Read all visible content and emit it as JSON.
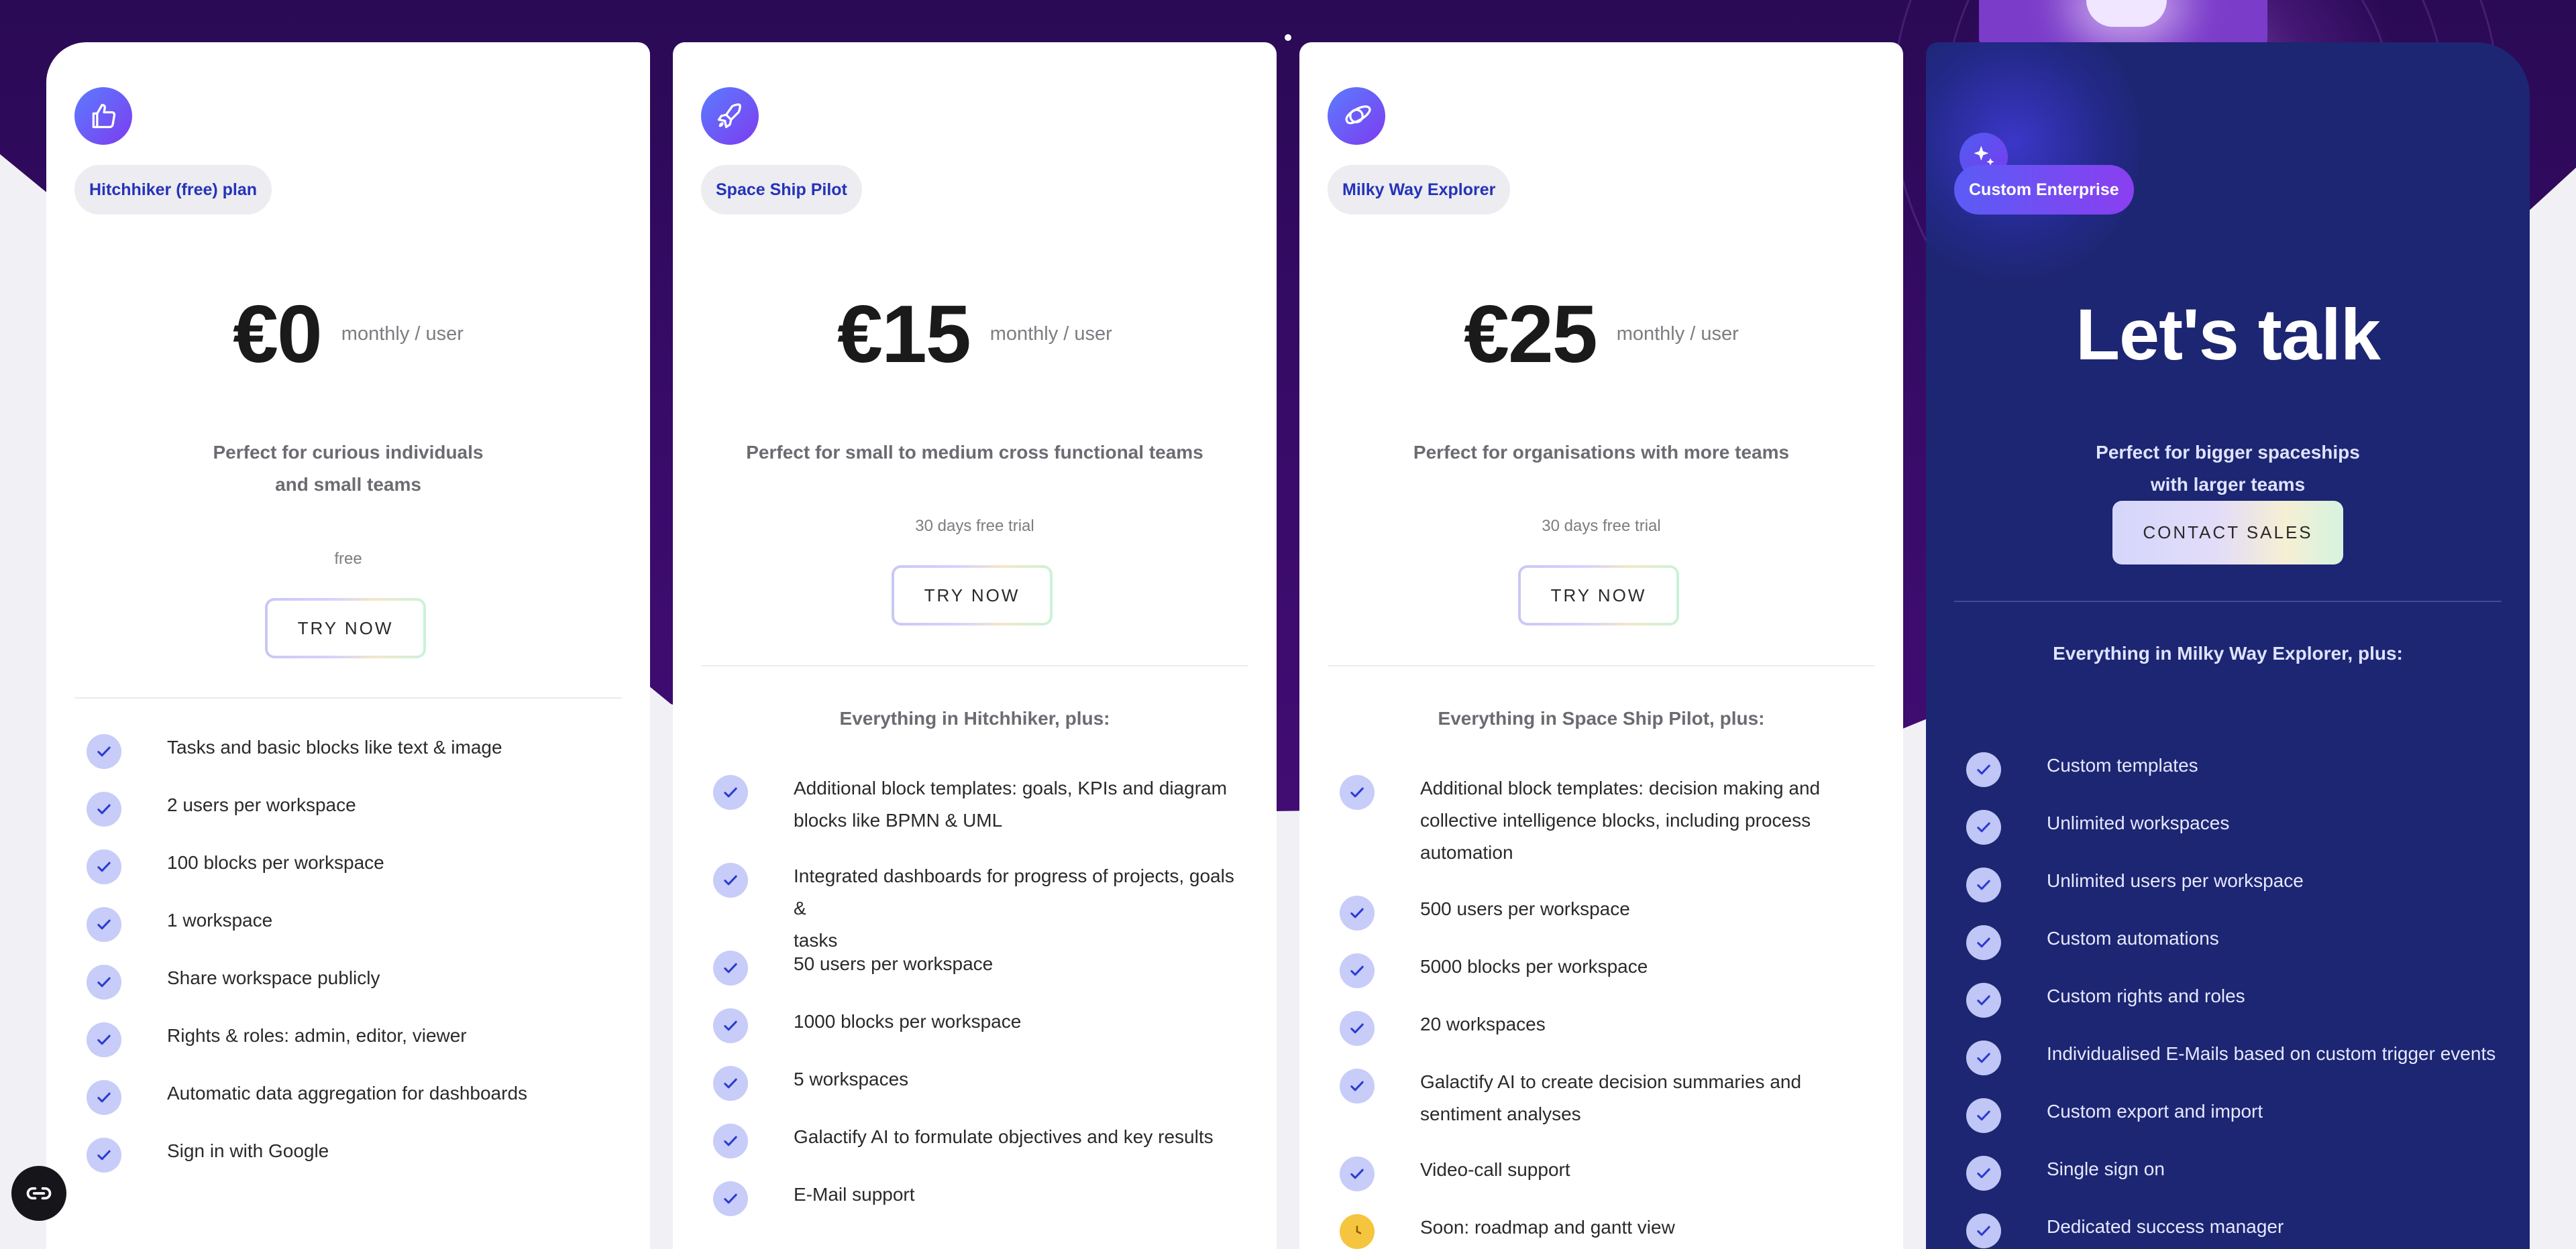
{
  "plans": [
    {
      "pill": "Hitchhiker (free) plan",
      "icon": "thumbs-up-icon",
      "price": "€0",
      "unit": "monthly / user",
      "desc_line1": "Perfect for curious individuals",
      "desc_line2": "and small teams",
      "note": "free",
      "button": "TRY NOW",
      "section_head": "",
      "features": [
        "Tasks and basic blocks like text & image",
        "2 users per workspace",
        "100 blocks per workspace",
        "1 workspace",
        "Share workspace publicly",
        "Rights & roles: admin, editor, viewer",
        "Automatic data aggregation for dashboards",
        "Sign in with Google"
      ]
    },
    {
      "pill": "Space Ship Pilot",
      "icon": "rocket-icon",
      "price": "€15",
      "unit": "monthly / user",
      "desc_line1": "Perfect for small to medium cross functional teams",
      "note": "30 days free trial",
      "button": "TRY NOW",
      "section_head": "Everything in Hitchhiker, plus:",
      "features": [
        {
          "l1": "Additional block templates: goals, KPIs and diagram",
          "l2": "blocks like BPMN & UML"
        },
        {
          "l1": "Integrated dashboards for progress of projects, goals &",
          "l2": "tasks"
        },
        "50 users per workspace",
        "1000 blocks per workspace",
        "5 workspaces",
        "Galactify AI to formulate objectives and key results",
        "E-Mail support"
      ]
    },
    {
      "pill": "Milky Way Explorer",
      "icon": "planet-icon",
      "price": "€25",
      "unit": "monthly / user",
      "desc_line1": "Perfect for organisations with more teams",
      "note": "30 days free trial",
      "button": "TRY NOW",
      "section_head": "Everything in Space Ship Pilot, plus:",
      "features": [
        {
          "l1": "Additional block templates: decision making and",
          "l2": "collective intelligence blocks, including process",
          "l3": "automation"
        },
        "500 users per workspace",
        "5000 blocks per workspace",
        "20 workspaces",
        {
          "l1": "Galactify AI to create decision summaries and",
          "l2": "sentiment analyses"
        },
        "Video-call support",
        "Soon: roadmap and gantt view"
      ]
    },
    {
      "pill": "Custom Enterprise",
      "icon": "sparkles-icon",
      "headline": "Let's talk",
      "desc_line1": "Perfect for bigger spaceships",
      "desc_line2": "with larger teams",
      "button": "CONTACT SALES",
      "section_head": "Everything in Milky Way Explorer, plus:",
      "features": [
        "Custom templates",
        "Unlimited workspaces",
        "Unlimited users per workspace",
        "Custom automations",
        "Custom rights and roles",
        "Individualised E-Mails based on custom trigger events",
        "Custom export and import",
        "Single sign on",
        "Dedicated success manager"
      ]
    }
  ],
  "colors": {
    "accent": "#2533b8",
    "enterprise_bg": "#1d2672",
    "check_bg": "#c7ccf8",
    "clock_bg": "#f6c53f"
  },
  "floating_button_icon": "cookie-settings-icon"
}
